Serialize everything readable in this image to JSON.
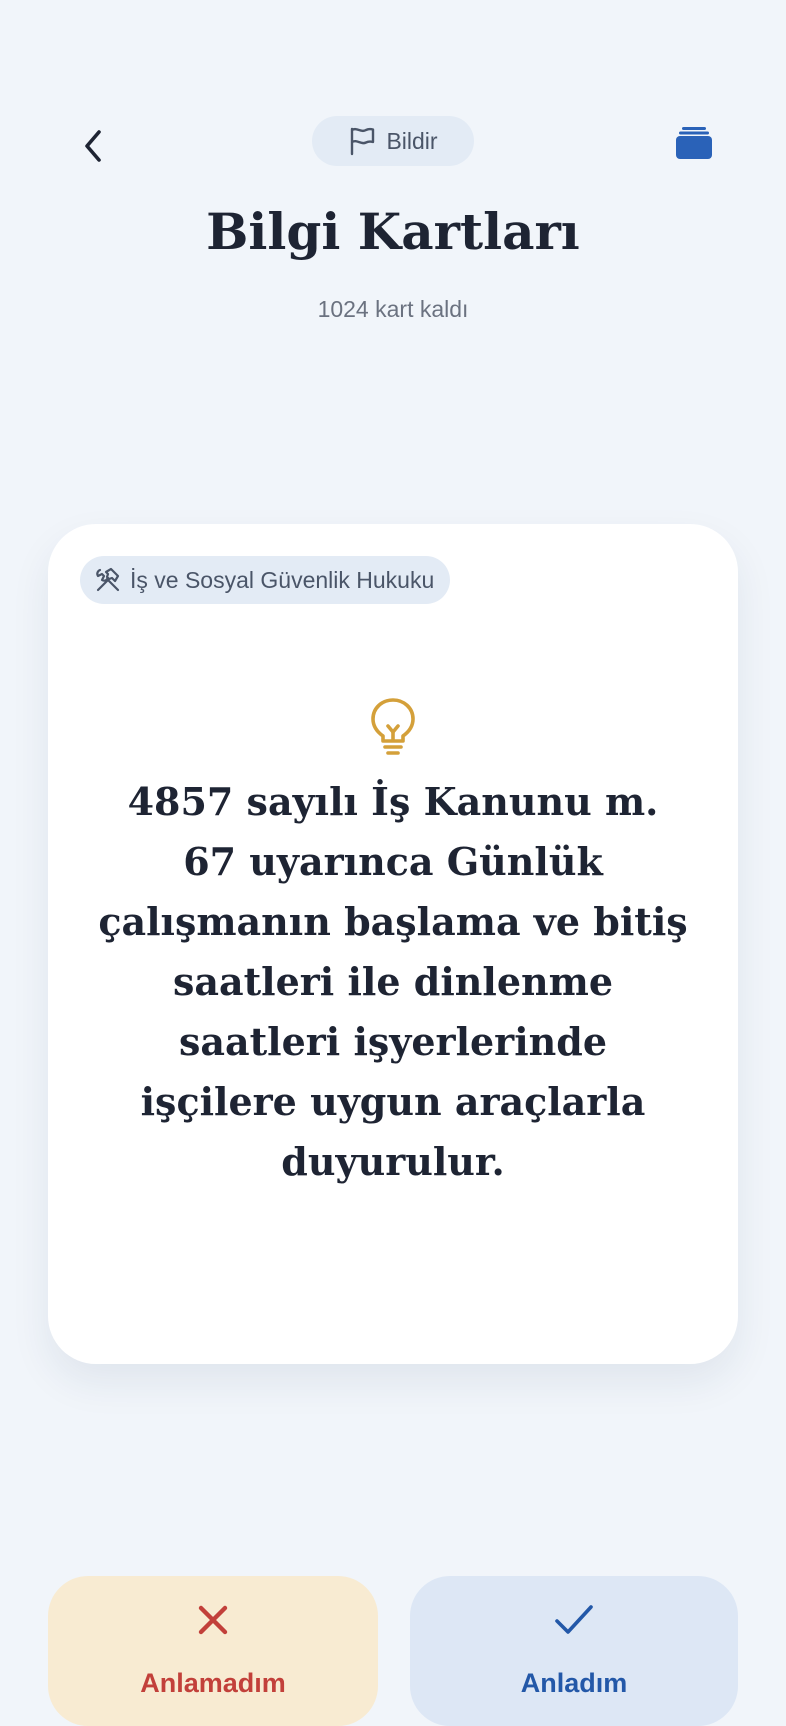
{
  "header": {
    "report_label": "Bildir",
    "title": "Bilgi Kartları",
    "remaining_text": "1024 kart kaldı"
  },
  "icons": {
    "back": "chevron-left-icon",
    "report": "flag-icon",
    "deck": "card-stack-icon",
    "category": "hammer-wrench-icon",
    "fact": "lightbulb-icon",
    "no": "x-mark-icon",
    "yes": "checkmark-icon"
  },
  "card": {
    "category": "İş ve Sosyal Güvenlik Hukuku",
    "text": "4857 sayılı İş Kanunu m. 67 uyarınca Günlük çalışmanın başlama ve bitiş saatleri ile dinlenme saatleri işyerlerinde işçilere uygun araçlarla duyurulur."
  },
  "actions": {
    "no_label": "Anlamadım",
    "yes_label": "Anladım"
  },
  "colors": {
    "background": "#f1f5fa",
    "accent_blue": "#2358a8",
    "deck_icon": "#2a62b8",
    "bulb": "#d4a03a",
    "no_text": "#c2403a",
    "no_bg": "#f8ebd2",
    "yes_bg": "#dde7f5",
    "pill_bg": "#e3ebf5"
  }
}
